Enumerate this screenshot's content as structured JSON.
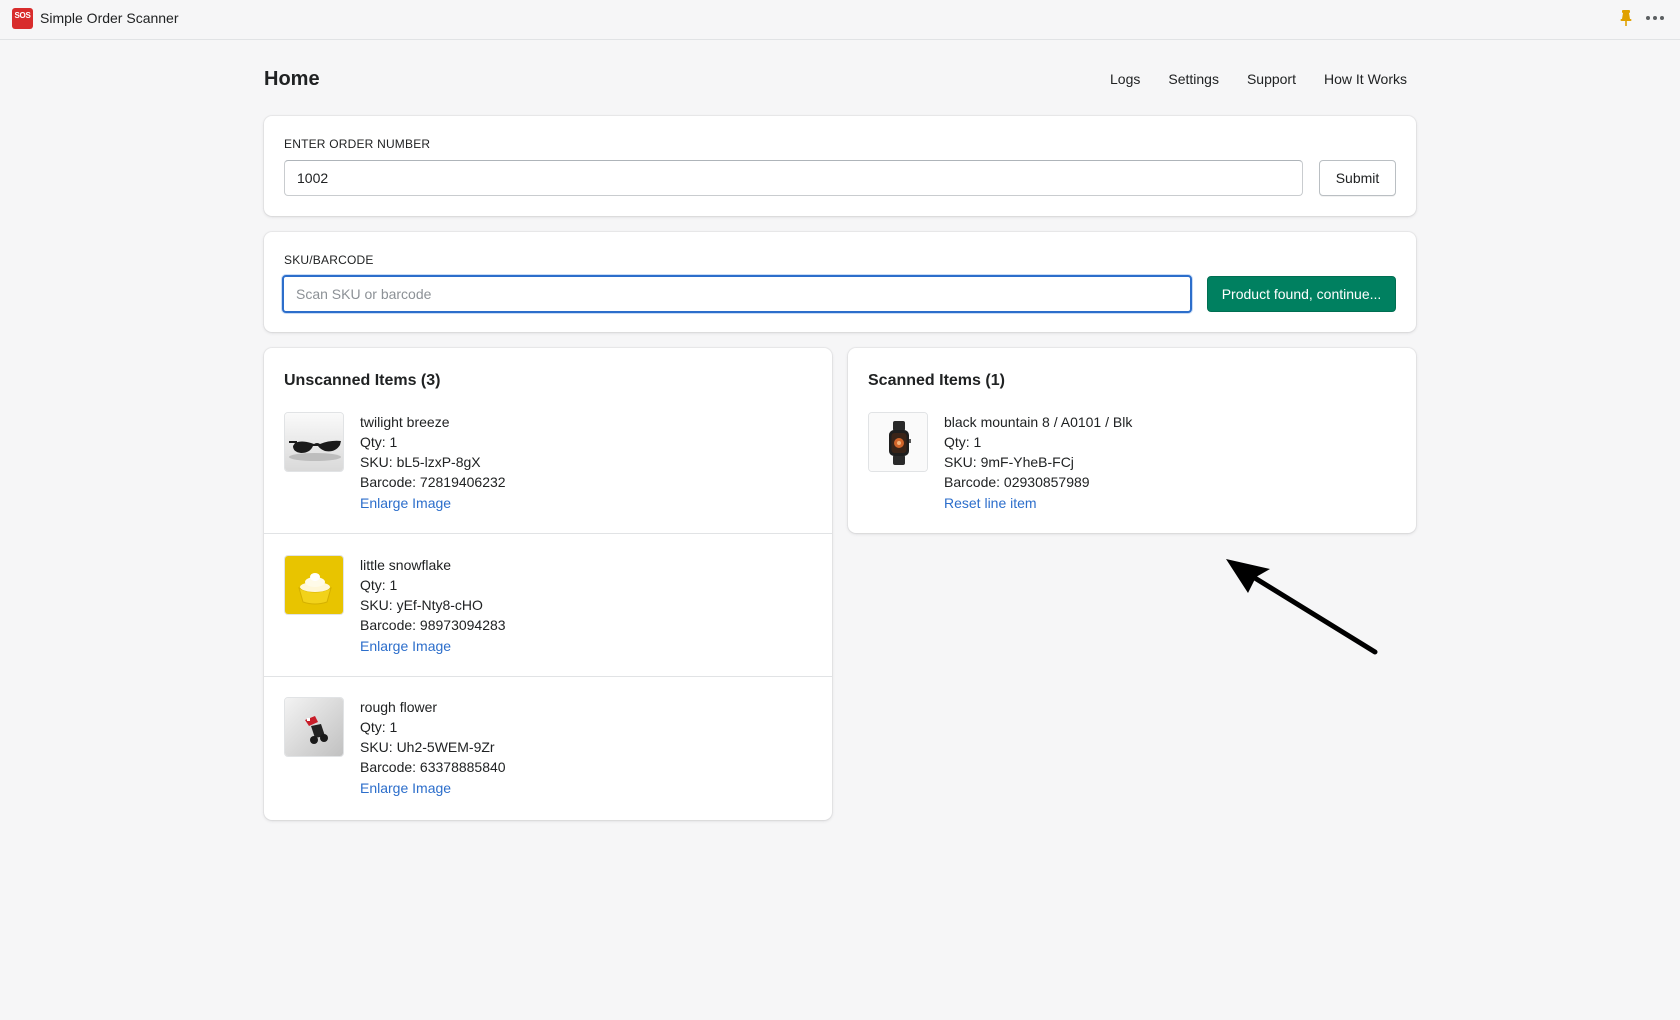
{
  "app": {
    "logo_text": "SOS",
    "title": "Simple Order Scanner"
  },
  "page": {
    "title": "Home",
    "nav": [
      "Logs",
      "Settings",
      "Support",
      "How It Works"
    ]
  },
  "order": {
    "label": "ENTER ORDER NUMBER",
    "value": "1002",
    "submit_label": "Submit"
  },
  "sku": {
    "label": "SKU/BARCODE",
    "placeholder": "Scan SKU or barcode",
    "value": "",
    "action_label": "Product found, continue..."
  },
  "unscanned": {
    "title": "Unscanned Items (3)",
    "items": [
      {
        "name": "twilight breeze",
        "qty": "Qty: 1",
        "sku": "SKU: bL5-lzxP-8gX",
        "barcode": "Barcode: 72819406232",
        "link": "Enlarge Image",
        "image": "sunglasses"
      },
      {
        "name": "little snowflake",
        "qty": "Qty: 1",
        "sku": "SKU: yEf-Nty8-cHO",
        "barcode": "Barcode: 98973094283",
        "link": "Enlarge Image",
        "image": "cupcake"
      },
      {
        "name": "rough flower",
        "qty": "Qty: 1",
        "sku": "SKU: Uh2-5WEM-9Zr",
        "barcode": "Barcode: 63378885840",
        "link": "Enlarge Image",
        "image": "toy"
      }
    ]
  },
  "scanned": {
    "title": "Scanned Items (1)",
    "items": [
      {
        "name": "black mountain 8 / A0101 / Blk",
        "qty": "Qty: 1",
        "sku": "SKU: 9mF-YheB-FCj",
        "barcode": "Barcode: 02930857989",
        "link": "Reset line item",
        "image": "smartwatch"
      }
    ]
  },
  "colors": {
    "primary": "#008060",
    "link": "#2c6ecb",
    "logo": "#d82c2c",
    "pin": "#e0a100"
  },
  "icons": {
    "pin": "pin-icon",
    "more": "more-icon"
  }
}
